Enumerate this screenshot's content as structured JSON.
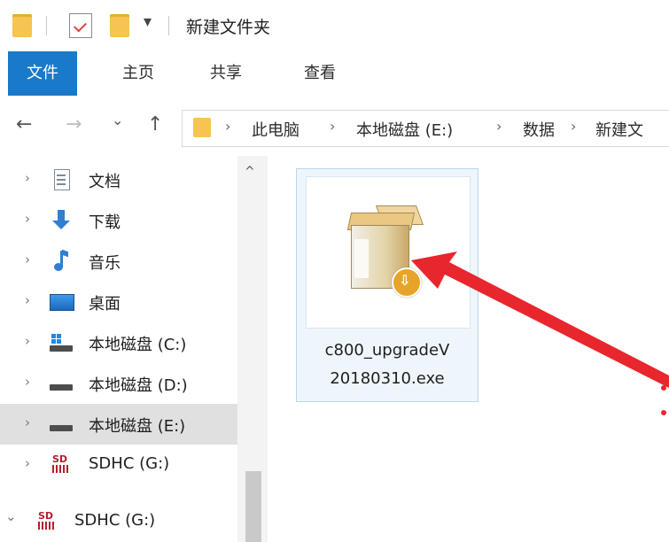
{
  "window": {
    "title": "新建文件夹",
    "qat_dropdown": "▾"
  },
  "ribbon": {
    "tabs": [
      {
        "label": "文件"
      },
      {
        "label": "主页"
      },
      {
        "label": "共享"
      },
      {
        "label": "查看"
      }
    ]
  },
  "address": {
    "back": "←",
    "forward": "→",
    "recent": "⌄",
    "up": "↑",
    "crumb_sep": "›",
    "crumbs": [
      "此电脑",
      "本地磁盘 (E:)",
      "数据",
      "新建文"
    ]
  },
  "nav": {
    "expand_glyph": "›",
    "expanded_glyph": "⌄",
    "scroll_up": "^",
    "items": [
      {
        "label": "文档",
        "icon": "document-icon"
      },
      {
        "label": "下载",
        "icon": "download-icon"
      },
      {
        "label": "音乐",
        "icon": "music-icon"
      },
      {
        "label": "桌面",
        "icon": "desktop-icon"
      },
      {
        "label": "本地磁盘 (C:)",
        "icon": "system-drive-icon"
      },
      {
        "label": "本地磁盘 (D:)",
        "icon": "drive-icon"
      },
      {
        "label": "本地磁盘 (E:)",
        "icon": "drive-icon",
        "selected": true
      },
      {
        "label": "SDHC (G:)",
        "icon": "sd-card-icon"
      },
      {
        "label": "SDHC (G:)",
        "icon": "sd-card-icon",
        "expanded": true
      }
    ]
  },
  "content": {
    "file": {
      "name_line1": "c800_upgradeV",
      "name_line2": "20180310.exe",
      "icon": "installer-icon",
      "badge_glyph": "⇩"
    }
  },
  "colors": {
    "file_tab": "#1979ca",
    "selection": "#e0e0e0",
    "tile_border": "#b9d7ef",
    "annotation": "#e8262d"
  }
}
